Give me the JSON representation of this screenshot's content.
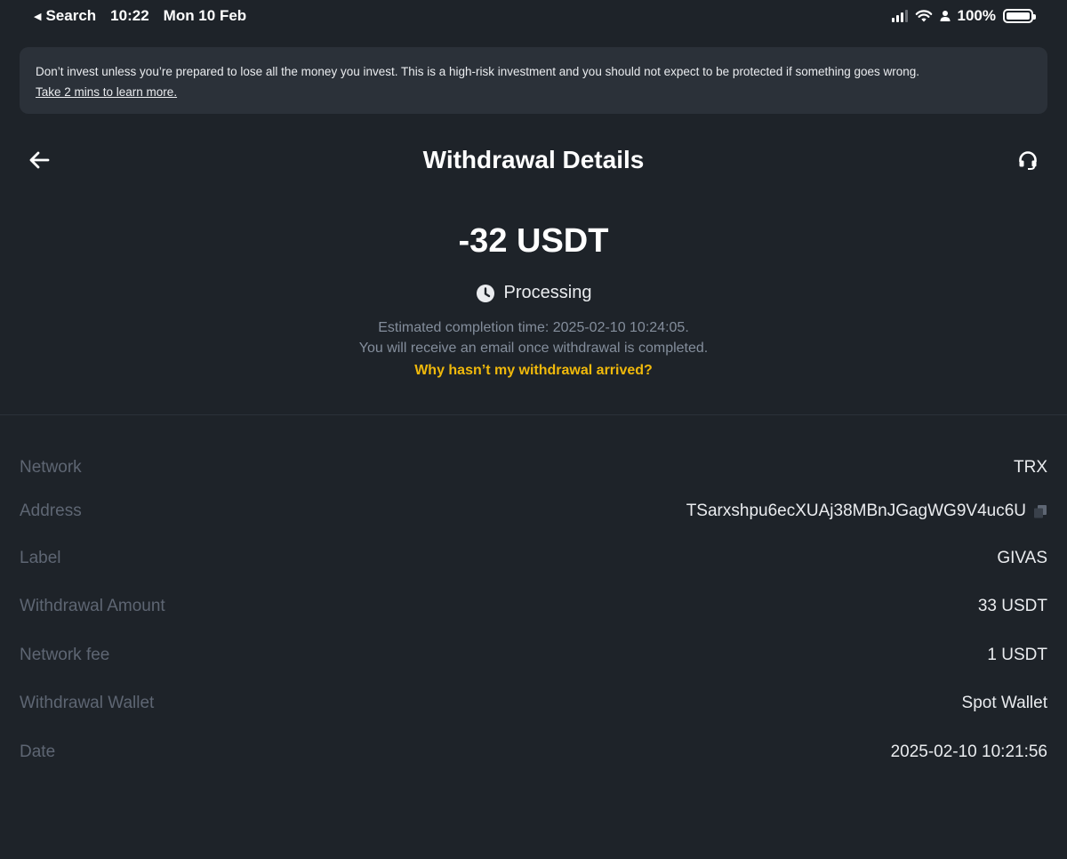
{
  "status_bar": {
    "back_app": "Search",
    "time": "10:22",
    "date": "Mon 10 Feb",
    "battery": "100%"
  },
  "warning": {
    "text": "Don’t invest unless you’re prepared to lose all the money you invest. This is a high-risk investment and you should not expect to be protected if something goes wrong.",
    "link": "Take 2 mins to learn more."
  },
  "header": {
    "title": "Withdrawal Details",
    "back_icon": "arrow-left-icon",
    "support_icon": "headset-icon"
  },
  "summary": {
    "amount": "-32 USDT",
    "status": "Processing",
    "status_icon": "clock-icon",
    "estimate": "Estimated completion time: 2025-02-10 10:24:05.",
    "email_note": "You will receive an email once withdrawal is completed.",
    "help_link": "Why hasn’t my withdrawal arrived?"
  },
  "colors": {
    "background": "#1e2329",
    "banner": "#2b3139",
    "accent": "#f0b90b",
    "label": "#5e6673",
    "muted": "#848e9c"
  },
  "details": [
    {
      "label": "Network",
      "value": "TRX"
    },
    {
      "label": "Address",
      "value": "TSarxshpu6ecXUAj38MBnJGagWG9V4uc6U"
    },
    {
      "label": "Label",
      "value": "GIVAS"
    },
    {
      "label": "Withdrawal Amount",
      "value": "33 USDT"
    },
    {
      "label": "Network fee",
      "value": "1 USDT"
    },
    {
      "label": "Withdrawal Wallet",
      "value": "Spot Wallet"
    },
    {
      "label": "Date",
      "value": "2025-02-10 10:21:56"
    }
  ]
}
